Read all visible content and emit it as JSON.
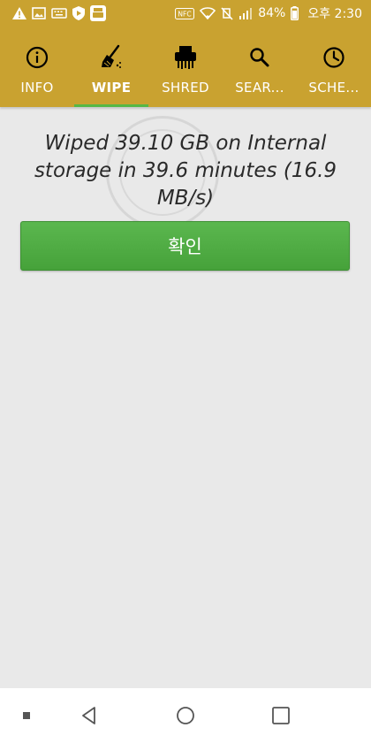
{
  "status_bar": {
    "icons_left": [
      "warning-icon",
      "image-icon",
      "keyboard-icon",
      "shield-icon",
      "app-icon"
    ],
    "icons_right": [
      "nfc-icon",
      "wifi-icon",
      "mute-icon",
      "signal-icon",
      "battery-icon"
    ],
    "nfc_label": "NFC",
    "battery_percent": "84%",
    "time": "오후 2:30"
  },
  "tabs": [
    {
      "label": "INFO",
      "icon": "info-icon",
      "active": false
    },
    {
      "label": "WIPE",
      "icon": "broom-icon",
      "active": true
    },
    {
      "label": "SHRED",
      "icon": "shredder-icon",
      "active": false
    },
    {
      "label": "SEAR...",
      "icon": "search-icon",
      "active": false
    },
    {
      "label": "SCHE...",
      "icon": "clock-icon",
      "active": false
    }
  ],
  "main": {
    "message": "Wiped 39.10 GB on Internal storage in 39.6 minutes (16.9 MB/s)",
    "confirm_label": "확인"
  },
  "nav": {
    "items": [
      "menu-dot-icon",
      "back-icon",
      "home-icon",
      "recents-icon"
    ]
  },
  "colors": {
    "primary": "#c9a230",
    "accent": "#55b845",
    "button": "#4caf50",
    "background": "#e9e9e9"
  }
}
